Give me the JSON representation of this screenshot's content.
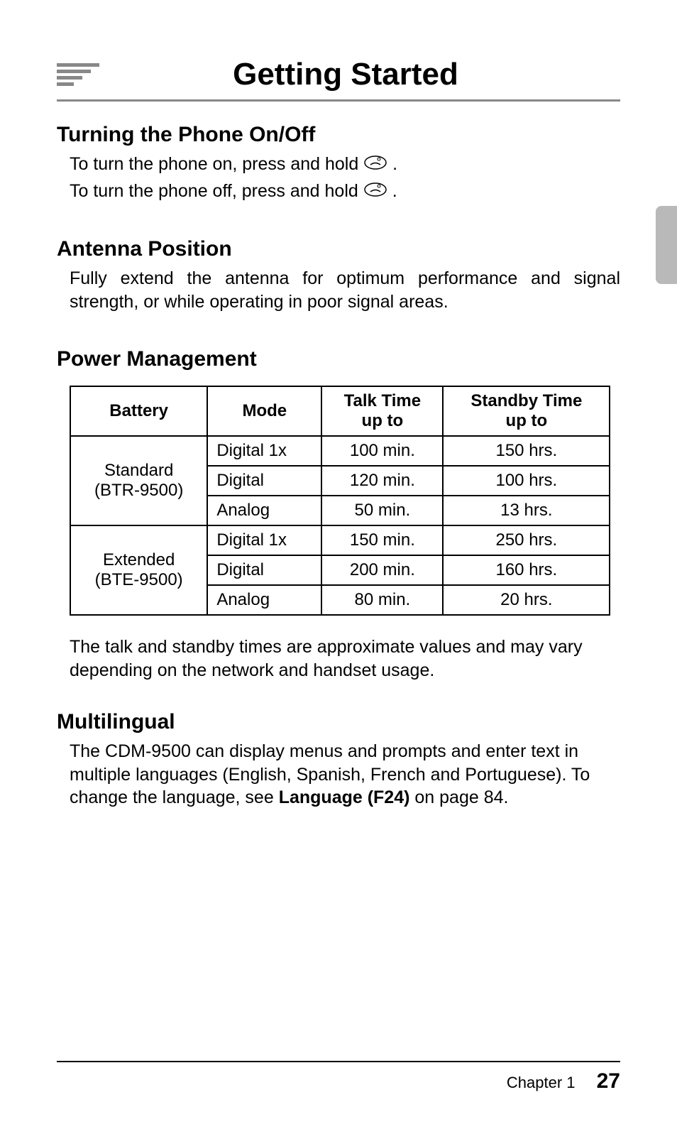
{
  "header": {
    "title": "Getting Started"
  },
  "sections": {
    "turning": {
      "heading": "Turning the Phone On/Off",
      "line1_a": "To turn the phone on, press and hold ",
      "line1_b": ".",
      "line2_a": "To turn the phone off, press and hold ",
      "line2_b": "."
    },
    "antenna": {
      "heading": "Antenna Position",
      "body": "Fully extend the antenna for optimum performance and signal strength, or while operating in poor signal areas."
    },
    "power": {
      "heading": "Power Management",
      "headers": {
        "battery": "Battery",
        "mode": "Mode",
        "talk_a": "Talk Time",
        "talk_b": "up to",
        "standby_a": "Standby Time",
        "standby_b": "up to"
      },
      "groups": [
        {
          "battery_a": "Standard",
          "battery_b": "(BTR-9500)",
          "rows": [
            {
              "mode": "Digital 1x",
              "talk": "100 min.",
              "standby": "150 hrs."
            },
            {
              "mode": "Digital",
              "talk": "120 min.",
              "standby": "100 hrs."
            },
            {
              "mode": "Analog",
              "talk": "50 min.",
              "standby": "13 hrs."
            }
          ]
        },
        {
          "battery_a": "Extended",
          "battery_b": "(BTE-9500)",
          "rows": [
            {
              "mode": "Digital 1x",
              "talk": "150 min.",
              "standby": "250 hrs."
            },
            {
              "mode": "Digital",
              "talk": "200 min.",
              "standby": "160 hrs."
            },
            {
              "mode": "Analog",
              "talk": "80 min.",
              "standby": "20 hrs."
            }
          ]
        }
      ],
      "note": "The talk and standby times are approximate values and may vary depending on the network and handset usage."
    },
    "multilingual": {
      "heading": "Multilingual",
      "body_a": "The CDM-9500 can display menus and prompts and enter text in multiple languages (English, Spanish, French and Portuguese).  To change the language, see ",
      "body_bold": "Language (F24)",
      "body_b": " on page 84."
    }
  },
  "footer": {
    "chapter": "Chapter 1",
    "page": "27"
  }
}
